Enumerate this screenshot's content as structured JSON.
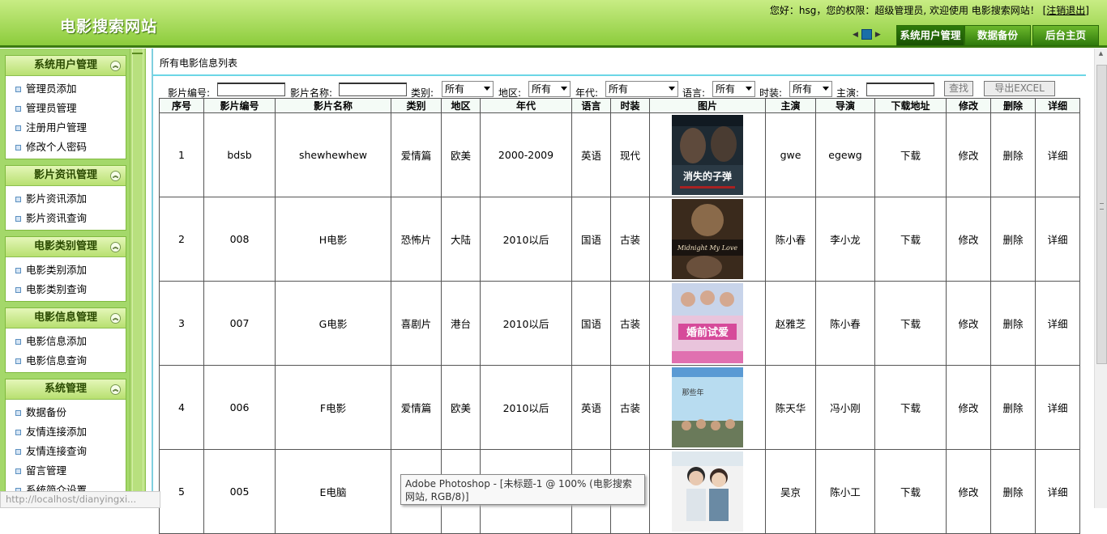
{
  "header": {
    "site_title": "电影搜索网站",
    "welcome_text": "您好：hsg，您的权限：超级管理员, 欢迎使用 电影搜索网站！",
    "logout": "[注销退出]",
    "buttons": [
      "系统用户管理",
      "数据备份",
      "后台主页"
    ]
  },
  "sidebar": {
    "sections": [
      {
        "title": "系统用户管理",
        "items": [
          "管理员添加",
          "管理员管理",
          "注册用户管理",
          "修改个人密码"
        ]
      },
      {
        "title": "影片资讯管理",
        "items": [
          "影片资讯添加",
          "影片资讯查询"
        ]
      },
      {
        "title": "电影类别管理",
        "items": [
          "电影类别添加",
          "电影类别查询"
        ]
      },
      {
        "title": "电影信息管理",
        "items": [
          "电影信息添加",
          "电影信息查询"
        ]
      },
      {
        "title": "系统管理",
        "items": [
          "数据备份",
          "友情连接添加",
          "友情连接查询",
          "留言管理",
          "系统简介设置"
        ]
      }
    ]
  },
  "main": {
    "list_title": "所有电影信息列表",
    "search": {
      "code_label": "影片编号:",
      "name_label": "影片名称:",
      "type_label": "类别:",
      "type_value": "所有",
      "region_label": "地区:",
      "region_value": "所有",
      "era_label": "年代:",
      "era_value": "所有",
      "lang_label": "语言:",
      "lang_value": "所有",
      "costume_label": "时装:",
      "costume_value": "所有",
      "actor_label": "主演:",
      "search_button": "查找",
      "export_button": "导出EXCEL"
    },
    "table": {
      "headers": [
        "序号",
        "影片编号",
        "影片名称",
        "类别",
        "地区",
        "年代",
        "语言",
        "时装",
        "图片",
        "主演",
        "导演",
        "下载地址",
        "修改",
        "删除",
        "详细"
      ],
      "rows": [
        {
          "no": "1",
          "code": "bdsb",
          "name": "shewhewhew",
          "type": "爱情篇",
          "region": "欧美",
          "era": "2000-2009",
          "lang": "英语",
          "costume": "现代",
          "poster_text": "消失的子弹",
          "actor": "gwe",
          "director": "egewg",
          "download": "下载",
          "edit": "修改",
          "delete": "删除",
          "detail": "详细"
        },
        {
          "no": "2",
          "code": "008",
          "name": "H电影",
          "type": "恐怖片",
          "region": "大陆",
          "era": "2010以后",
          "lang": "国语",
          "costume": "古装",
          "poster_text": "Midnight My Love",
          "actor": "陈小春",
          "director": "李小龙",
          "download": "下载",
          "edit": "修改",
          "delete": "删除",
          "detail": "详细"
        },
        {
          "no": "3",
          "code": "007",
          "name": "G电影",
          "type": "喜剧片",
          "region": "港台",
          "era": "2010以后",
          "lang": "国语",
          "costume": "古装",
          "poster_text": "婚前试爱",
          "actor": "赵雅芝",
          "director": "陈小春",
          "download": "下载",
          "edit": "修改",
          "delete": "删除",
          "detail": "详细"
        },
        {
          "no": "4",
          "code": "006",
          "name": "F电影",
          "type": "爱情篇",
          "region": "欧美",
          "era": "2010以后",
          "lang": "英语",
          "costume": "古装",
          "poster_text": "那些年",
          "actor": "陈天华",
          "director": "冯小刚",
          "download": "下载",
          "edit": "修改",
          "delete": "删除",
          "detail": "详细"
        },
        {
          "no": "5",
          "code": "005",
          "name": "E电脑",
          "type": "",
          "region": "",
          "era": "",
          "lang": "",
          "costume": "",
          "poster_text": "",
          "actor": "吴京",
          "director": "陈小工",
          "download": "下载",
          "edit": "修改",
          "delete": "删除",
          "detail": "详细"
        }
      ]
    }
  },
  "status_url": "http://localhost/dianyingxi...",
  "tooltip": "Adobe Photoshop - [未标题-1 @ 100% (电影搜索网站, RGB/8)]"
}
